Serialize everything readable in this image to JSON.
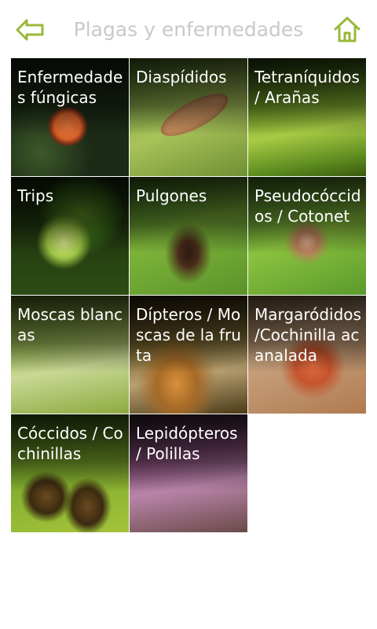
{
  "header": {
    "title": "Plagas y enfermedades",
    "back_icon": "back-arrow-icon",
    "home_icon": "home-icon"
  },
  "colors": {
    "accent": "#9ab83a",
    "title": "#c9c9c9",
    "background": "#ffffff"
  },
  "categories": [
    {
      "label": "Enfermedades fúngicas"
    },
    {
      "label": "Diaspídidos"
    },
    {
      "label": "Tetraníquidos / Arañas"
    },
    {
      "label": "Trips"
    },
    {
      "label": "Pulgones"
    },
    {
      "label": "Pseudocóccidos / Cotonet"
    },
    {
      "label": "Moscas blancas"
    },
    {
      "label": "Dípteros / Moscas de la fruta"
    },
    {
      "label": "Margaródidos /Cochinilla acanalada"
    },
    {
      "label": "Cóccidos / Cochinillas"
    },
    {
      "label": "Lepidópteros / Polillas"
    }
  ]
}
